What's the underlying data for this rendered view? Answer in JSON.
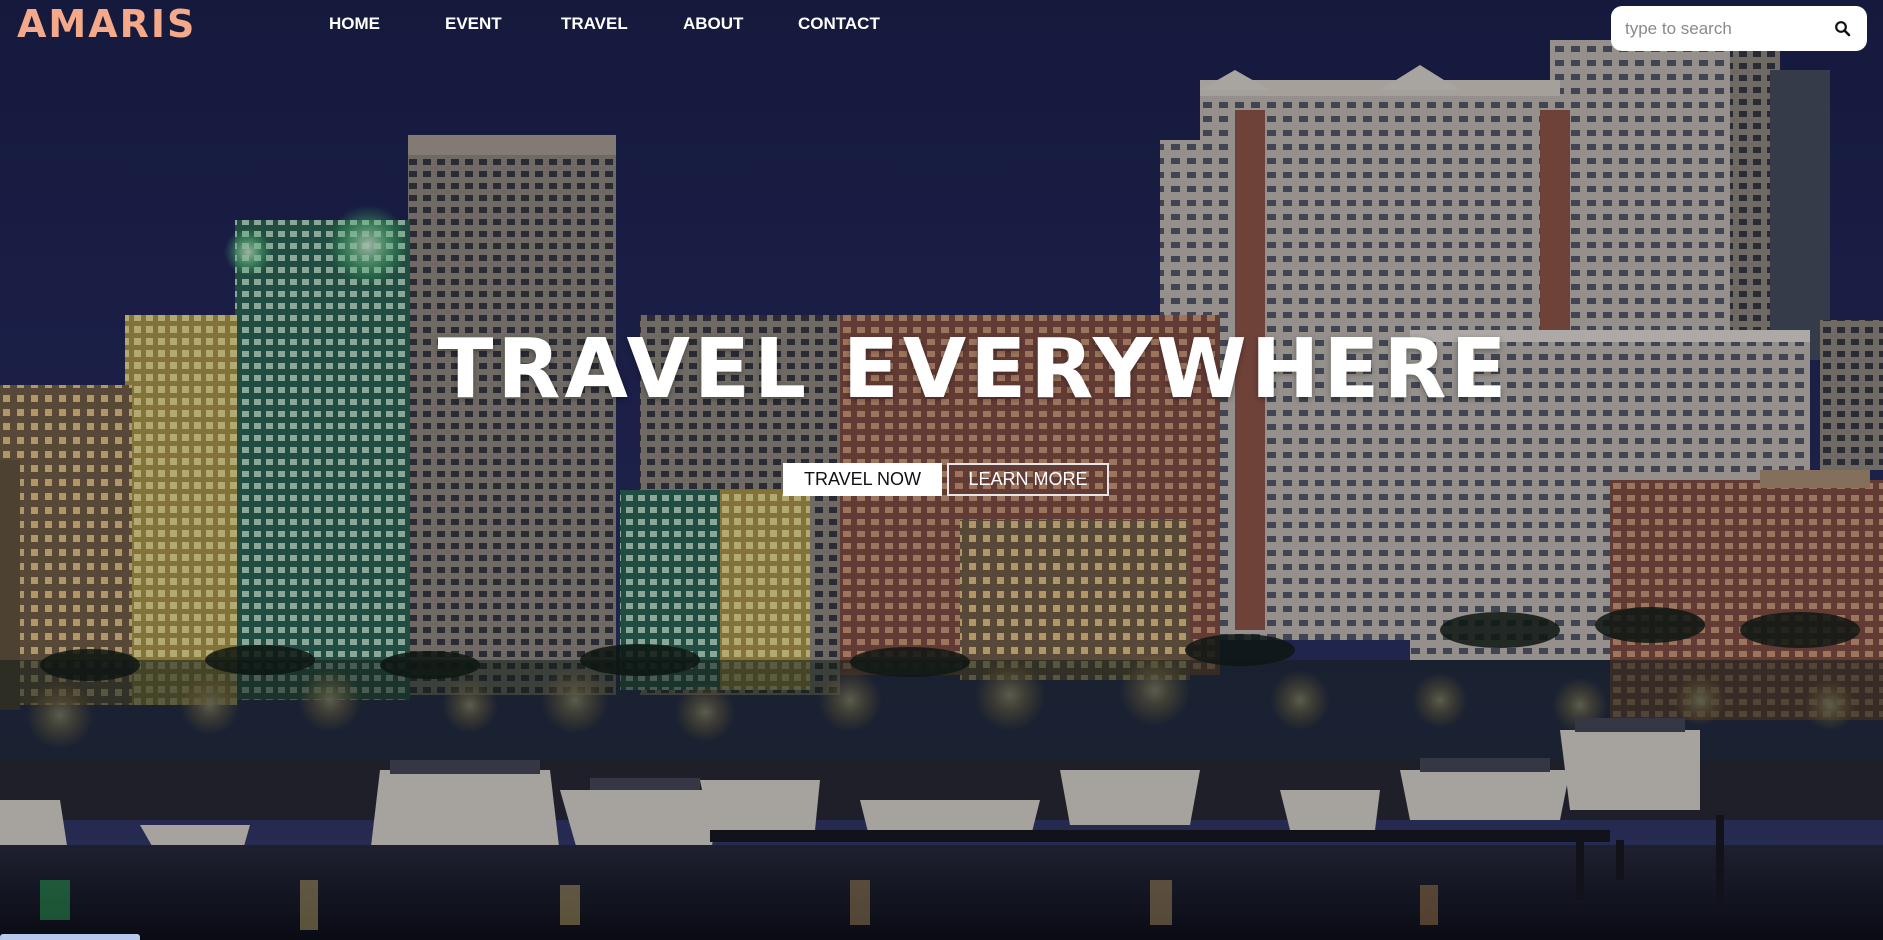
{
  "brand": {
    "logo": "AMARIS",
    "logo_color": "#f4a98a"
  },
  "nav": {
    "items": [
      {
        "label": "HOME"
      },
      {
        "label": "EVENT"
      },
      {
        "label": "TRAVEL"
      },
      {
        "label": "ABOUT"
      },
      {
        "label": "CONTACT"
      }
    ]
  },
  "search": {
    "placeholder": "type to search",
    "value": "",
    "icon": "search-icon"
  },
  "hero": {
    "title": "TRAVEL EVERYWHERE",
    "primary_button": "TRAVEL NOW",
    "secondary_button": "LEARN MORE"
  },
  "background": {
    "description_icon": "city-skyline-night-image",
    "sky_color": "#1f2552"
  }
}
